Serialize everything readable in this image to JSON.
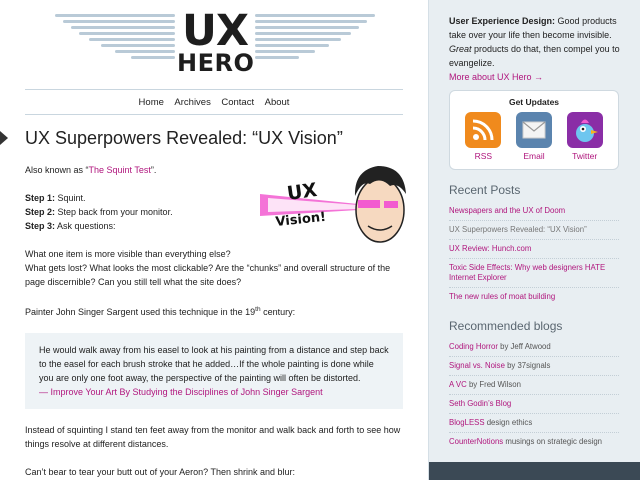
{
  "header": {
    "logo_top": "UX",
    "logo_bottom": "HERO"
  },
  "nav": [
    "Home",
    "Archives",
    "Contact",
    "About"
  ],
  "post": {
    "title": "UX Superpowers Revealed: “UX Vision”",
    "also_known_prefix": "Also known as “",
    "also_known_link": "The Squint Test",
    "also_known_suffix": "”.",
    "steps": [
      {
        "label": "Step 1:",
        "text": " Squint."
      },
      {
        "label": "Step 2:",
        "text": " Step back from your monitor."
      },
      {
        "label": "Step 3:",
        "text": " Ask questions:"
      }
    ],
    "questions_1": "What one item is more visible than everything else?",
    "questions_2": "What gets lost? What looks the most clickable? Are the “chunks” and overall structure of the page discernible? Can you still tell what the site does?",
    "painter_prefix": "Painter John Singer Sargent used this technique in the 19",
    "painter_sup": "th",
    "painter_suffix": " century:",
    "quote_text": "He would walk away from his easel to look at his painting from a distance and step back to the easel for each brush stroke that he added…If the whole painting is done while you are only one foot away, the perspective of the painting will often be distorted.",
    "quote_dash": "— ",
    "quote_link": "Improve Your Art By Studying the Disciplines of John Singer Sargent",
    "para_after": "Instead of squinting I stand ten feet away from the monitor and walk back and forth to see how things resolve at different distances.",
    "para_last": "Can’t bear to tear your butt out of your Aeron? Then shrink and blur:",
    "art_text_1": "UX",
    "art_text_2": "Vision!"
  },
  "sidebar": {
    "about_heading": "User Experience Design:",
    "about_text_1": " Good products take over your life then become invisible. ",
    "about_em": "Great",
    "about_text_2": " products do that, then compel you to evangelize.",
    "about_link": "More about UX Hero →",
    "updates_title": "Get Updates",
    "subscribe": [
      {
        "label": "RSS",
        "icon": "rss-icon"
      },
      {
        "label": "Email",
        "icon": "email-icon"
      },
      {
        "label": "Twitter",
        "icon": "twitter-bird-icon"
      }
    ],
    "recent_heading": "Recent Posts",
    "recent_posts": [
      {
        "title": "Newspapers and the UX of Doom",
        "current": false
      },
      {
        "title": "UX Superpowers Revealed: “UX Vision”",
        "current": true
      },
      {
        "title": "UX Review: Hunch.com",
        "current": false
      },
      {
        "title": "Toxic Side Effects: Why web designers HATE Internet Explorer",
        "current": false
      },
      {
        "title": "The new rules of moat building",
        "current": false
      }
    ],
    "blogs_heading": "Recommended blogs",
    "blogs": [
      {
        "name": "Coding Horror",
        "by": " by Jeff Atwood"
      },
      {
        "name": "Signal vs. Noise",
        "by": " by 37signals"
      },
      {
        "name": "A VC",
        "by": " by Fred Wilson"
      },
      {
        "name": "Seth Godin’s Blog",
        "by": ""
      },
      {
        "name": "BlogLESS",
        "by": " design ethics"
      },
      {
        "name": "CounterNotions",
        "by": " musings on strategic design"
      }
    ]
  },
  "colors": {
    "link": "#b0167d",
    "sidebar_bg": "#e8eef2",
    "rss": "#f08a1d",
    "email": "#5b84ae",
    "twitter": "#8a2ea6"
  }
}
